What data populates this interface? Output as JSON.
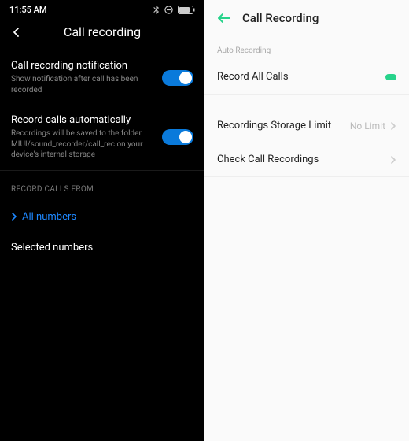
{
  "left": {
    "status": {
      "time": "11:55 AM"
    },
    "header": {
      "title": "Call recording"
    },
    "items": [
      {
        "title": "Call recording notification",
        "desc": "Show notification after call has been recorded"
      },
      {
        "title": "Record calls automatically",
        "desc": "Recordings will be saved to the folder MIUI/sound_recorder/call_rec on your device's internal storage"
      }
    ],
    "section_header": "RECORD CALLS FROM",
    "options": [
      {
        "label": "All numbers"
      },
      {
        "label": "Selected numbers"
      }
    ]
  },
  "right": {
    "header": {
      "title": "Call Recording"
    },
    "section_header": "Auto Recording",
    "rows": [
      {
        "label": "Record All Calls",
        "value": ""
      },
      {
        "label": "Recordings Storage Limit",
        "value": "No Limit"
      },
      {
        "label": "Check Call Recordings",
        "value": ""
      }
    ]
  }
}
